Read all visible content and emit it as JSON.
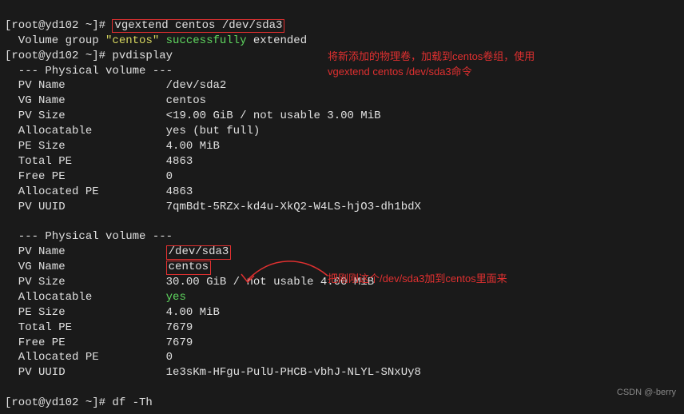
{
  "line1": {
    "prompt": "[root@yd102 ~]# ",
    "cmd": "vgextend centos /dev/sda3"
  },
  "line2": {
    "prefix": "  Volume group ",
    "name": "\"centos\"",
    "mid": " ",
    "status": "successfully",
    "suffix": " extended"
  },
  "line3": {
    "prompt": "[root@yd102 ~]# ",
    "cmd": "pvdisplay"
  },
  "pv1": {
    "header": "  --- Physical volume ---",
    "rows": [
      {
        "label": "  PV Name",
        "value": "/dev/sda2"
      },
      {
        "label": "  VG Name",
        "value": "centos"
      },
      {
        "label": "  PV Size",
        "value": "<19.00 GiB / not usable 3.00 MiB"
      },
      {
        "label": "  Allocatable",
        "value": "yes (but full)"
      },
      {
        "label": "  PE Size",
        "value": "4.00 MiB"
      },
      {
        "label": "  Total PE",
        "value": "4863"
      },
      {
        "label": "  Free PE",
        "value": "0"
      },
      {
        "label": "  Allocated PE",
        "value": "4863"
      },
      {
        "label": "  PV UUID",
        "value": "7qmBdt-5RZx-kd4u-XkQ2-W4LS-hjO3-dh1bdX"
      }
    ]
  },
  "pv2": {
    "header": "  --- Physical volume ---",
    "pvname_label": "  PV Name",
    "pvname_value": "/dev/sda3",
    "vgname_label": "  VG Name",
    "vgname_value": "centos",
    "pvsize_label": "  PV Size",
    "pvsize_value": "30.00 GiB / not usable 4.00 MiB",
    "alloc_label": "  Allocatable",
    "alloc_value": "yes",
    "rows2": [
      {
        "label": "  PE Size",
        "value": "4.00 MiB"
      },
      {
        "label": "  Total PE",
        "value": "7679"
      },
      {
        "label": "  Free PE",
        "value": "7679"
      },
      {
        "label": "  Allocated PE",
        "value": "0"
      },
      {
        "label": "  PV UUID",
        "value": "1e3sKm-HFgu-PulU-PHCB-vbhJ-NLYL-SNxUy8"
      }
    ]
  },
  "lastline": {
    "prompt": "[root@yd102 ~]# ",
    "cmd": "df -Th"
  },
  "annotations": {
    "a1_line1": "将新添加的物理卷，加载到centos卷组，使用",
    "a1_line2": "vgextend centos /dev/sda3命令",
    "a2": "把刚刚这个/dev/sda3加到centos里面来"
  },
  "watermark": "CSDN @-berry"
}
